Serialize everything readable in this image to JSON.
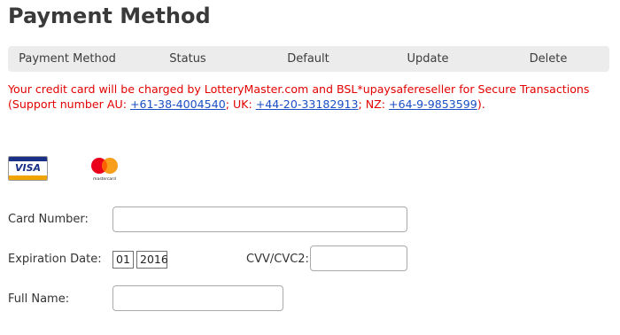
{
  "page": {
    "title": "Payment Method"
  },
  "table": {
    "headers": [
      "Payment Method",
      "Status",
      "Default",
      "Update",
      "Delete"
    ]
  },
  "notice": {
    "line1": "Your credit card will be charged by LotteryMaster.com and BSL*upaysafereseller for Secure Transactions",
    "line2_prefix": "(Support number AU: ",
    "au_phone": "+61-38-4004540",
    "sep_uk": "; UK: ",
    "uk_phone": "+44-20-33182913",
    "sep_nz": "; NZ: ",
    "nz_phone": "+64-9-9853599",
    "line2_suffix": ").",
    "color": "#e30000",
    "link_color": "#1a4fc4"
  },
  "card_logos": {
    "visa_text": "VISA",
    "mastercard_text": "mastercard"
  },
  "form": {
    "card_number_label": "Card Number:",
    "card_number_value": "",
    "expiration_label": "Expiration Date:",
    "exp_month": "01",
    "exp_year": "2016",
    "cvv_label": "CVV/CVC2:",
    "cvv_value": "",
    "full_name_label": "Full Name:",
    "full_name_value": ""
  }
}
